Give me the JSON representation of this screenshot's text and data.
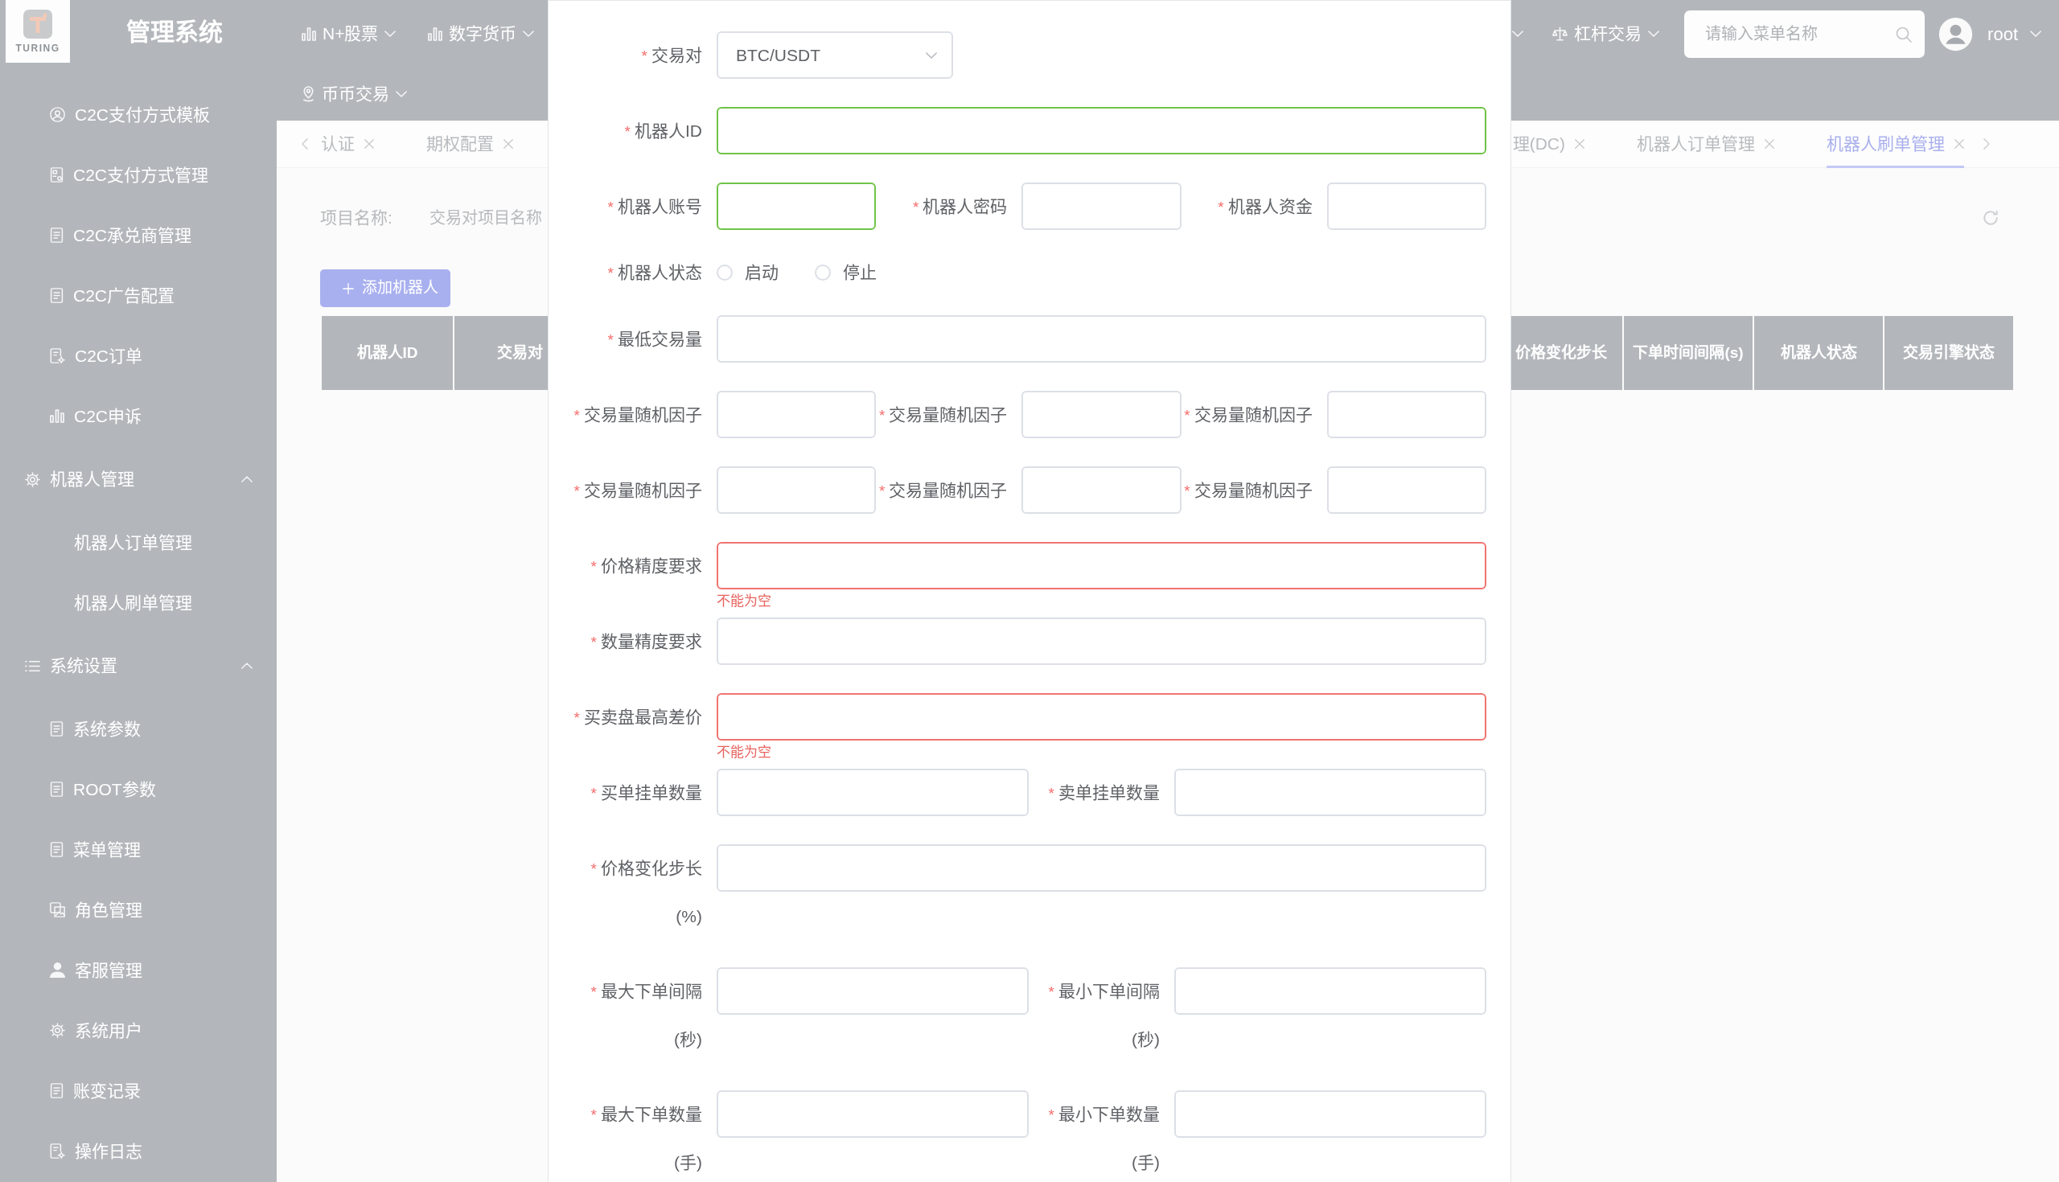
{
  "brand": {
    "logo_text": "TURING",
    "title": "管理系统"
  },
  "header": {
    "menu_row_1": [
      "N+股票",
      "数字货币"
    ],
    "menu_row_1_right": [
      "杠杆交易"
    ],
    "menu_row_2": [
      "币币交易"
    ],
    "search": {
      "placeholder": "请输入菜单名称"
    },
    "user": {
      "name": "root"
    }
  },
  "sidebar": {
    "items": [
      {
        "kind": "item",
        "label": "C2C支付方式模板"
      },
      {
        "kind": "item",
        "label": "C2C支付方式管理"
      },
      {
        "kind": "item",
        "label": "C2C承兑商管理"
      },
      {
        "kind": "item",
        "label": "C2C广告配置"
      },
      {
        "kind": "item",
        "label": "C2C订单"
      },
      {
        "kind": "item",
        "label": "C2C申诉"
      },
      {
        "kind": "group",
        "label": "机器人管理",
        "expanded": true,
        "children": [
          {
            "label": "机器人订单管理"
          },
          {
            "label": "机器人刷单管理"
          }
        ]
      },
      {
        "kind": "group",
        "label": "系统设置",
        "expanded": true,
        "children": [
          {
            "label": "系统参数"
          },
          {
            "label": "ROOT参数"
          },
          {
            "label": "菜单管理"
          },
          {
            "label": "角色管理"
          },
          {
            "label": "客服管理"
          },
          {
            "label": "系统用户"
          },
          {
            "label": "账变记录"
          },
          {
            "label": "操作日志"
          }
        ]
      }
    ]
  },
  "tabs": {
    "left": [
      {
        "label": "认证",
        "selected": false
      },
      {
        "label": "期权配置",
        "selected": false
      }
    ],
    "right": [
      {
        "label": "理(DC)",
        "selected": false
      },
      {
        "label": "机器人订单管理",
        "selected": false
      },
      {
        "label": "机器人刷单管理",
        "selected": true
      }
    ]
  },
  "filter": {
    "label": "项目名称:",
    "placeholder": "交易对项目名称"
  },
  "add_button": {
    "label": "添加机器人"
  },
  "table": {
    "columns_left": [
      "机器人ID",
      "交易对"
    ],
    "columns_right": [
      "价格变化步长",
      "下单时间间隔(s)",
      "机器人状态",
      "交易引擎状态"
    ]
  },
  "dialog": {
    "rows": [
      {
        "fields": [
          {
            "kind": "select",
            "required_mark": "*",
            "label": "交易对",
            "value": "BTC/USDT"
          }
        ]
      },
      {
        "fields": [
          {
            "kind": "input",
            "required_mark": "*",
            "label": "机器人ID",
            "valid": true,
            "invalid": false
          }
        ]
      },
      {
        "fields": [
          {
            "kind": "input",
            "required_mark": "*",
            "label": "机器人账号",
            "valid": true,
            "invalid": false
          },
          {
            "kind": "input",
            "required_mark": "*",
            "label": "机器人密码",
            "valid": false,
            "invalid": false
          },
          {
            "kind": "input",
            "required_mark": "*",
            "label": "机器人资金",
            "valid": false,
            "invalid": false
          }
        ]
      },
      {
        "fields": [
          {
            "kind": "radio",
            "required_mark": "*",
            "label": "机器人状态",
            "options": [
              {
                "label": "启动",
                "selected": false
              },
              {
                "label": "停止",
                "selected": false
              }
            ]
          }
        ]
      },
      {
        "fields": [
          {
            "kind": "input",
            "required_mark": "*",
            "label": "最低交易量",
            "valid": false,
            "invalid": false
          }
        ]
      },
      {
        "fields": [
          {
            "kind": "input",
            "required_mark": "*",
            "label": "交易量随机因子",
            "valid": false,
            "invalid": false
          },
          {
            "kind": "input",
            "required_mark": "*",
            "label": "交易量随机因子",
            "valid": false,
            "invalid": false
          },
          {
            "kind": "input",
            "required_mark": "*",
            "label": "交易量随机因子",
            "valid": false,
            "invalid": false
          }
        ]
      },
      {
        "fields": [
          {
            "kind": "input",
            "required_mark": "*",
            "label": "交易量随机因子",
            "valid": false,
            "invalid": false
          },
          {
            "kind": "input",
            "required_mark": "*",
            "label": "交易量随机因子",
            "valid": false,
            "invalid": false
          },
          {
            "kind": "input",
            "required_mark": "*",
            "label": "交易量随机因子",
            "valid": false,
            "invalid": false
          }
        ]
      },
      {
        "fields": [
          {
            "kind": "input",
            "required_mark": "*",
            "label": "价格精度要求",
            "valid": false,
            "invalid": true,
            "error": "不能为空"
          }
        ]
      },
      {
        "fields": [
          {
            "kind": "input",
            "required_mark": "*",
            "label": "数量精度要求",
            "valid": false,
            "invalid": false
          }
        ]
      },
      {
        "fields": [
          {
            "kind": "input",
            "required_mark": "*",
            "label": "买卖盘最高差价",
            "valid": false,
            "invalid": true,
            "error": "不能为空"
          }
        ]
      },
      {
        "fields": [
          {
            "kind": "input",
            "required_mark": "*",
            "label": "买单挂单数量",
            "valid": false,
            "invalid": false
          },
          {
            "kind": "input",
            "required_mark": "*",
            "label": "卖单挂单数量",
            "valid": false,
            "invalid": false
          }
        ]
      },
      {
        "fields": [
          {
            "kind": "input",
            "required_mark": "*",
            "label": "价格变化步长",
            "unit": "(%)",
            "valid": false,
            "invalid": false
          }
        ]
      },
      {
        "fields": [
          {
            "kind": "input",
            "required_mark": "*",
            "label": "最大下单间隔",
            "unit": "(秒)",
            "valid": false,
            "invalid": false
          },
          {
            "kind": "input",
            "required_mark": "*",
            "label": "最小下单间隔",
            "unit": "(秒)",
            "valid": false,
            "invalid": false
          }
        ]
      },
      {
        "fields": [
          {
            "kind": "input",
            "required_mark": "*",
            "label": "最大下单数量",
            "unit": "(手)",
            "valid": false,
            "invalid": false
          },
          {
            "kind": "input",
            "required_mark": "*",
            "label": "最小下单数量",
            "unit": "(手)",
            "valid": false,
            "invalid": false
          }
        ]
      }
    ]
  }
}
